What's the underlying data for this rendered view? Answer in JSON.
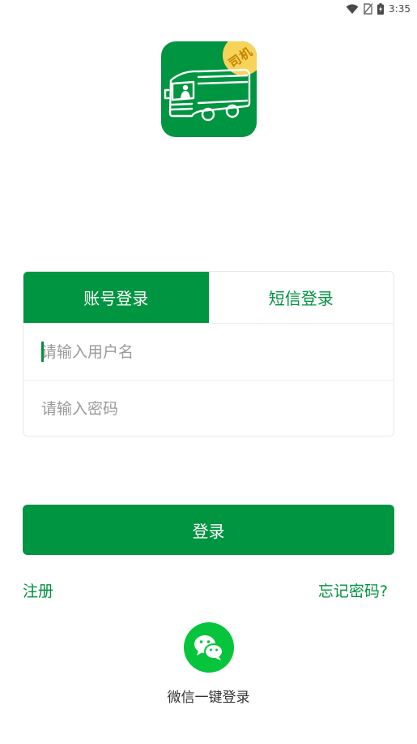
{
  "status_bar": {
    "time": "3:35",
    "icons": [
      "wifi-icon",
      "no-sim-icon",
      "battery-charging-icon"
    ]
  },
  "app_logo": {
    "badge_text": "司机",
    "icon": "truck-icon",
    "background_color": "#009540",
    "badge_color": "#f7d35a"
  },
  "login": {
    "tabs": [
      {
        "label": "账号登录",
        "active": true
      },
      {
        "label": "短信登录",
        "active": false
      }
    ],
    "username": {
      "placeholder": "请输入用户名",
      "value": ""
    },
    "password": {
      "placeholder": "请输入密码",
      "value": ""
    },
    "submit_label": "登录"
  },
  "links": {
    "register": "注册",
    "forgot_password": "忘记密码?"
  },
  "wechat": {
    "icon": "wechat-icon",
    "label": "微信一键登录",
    "color": "#06c43b"
  },
  "theme": {
    "accent": "#009540"
  }
}
